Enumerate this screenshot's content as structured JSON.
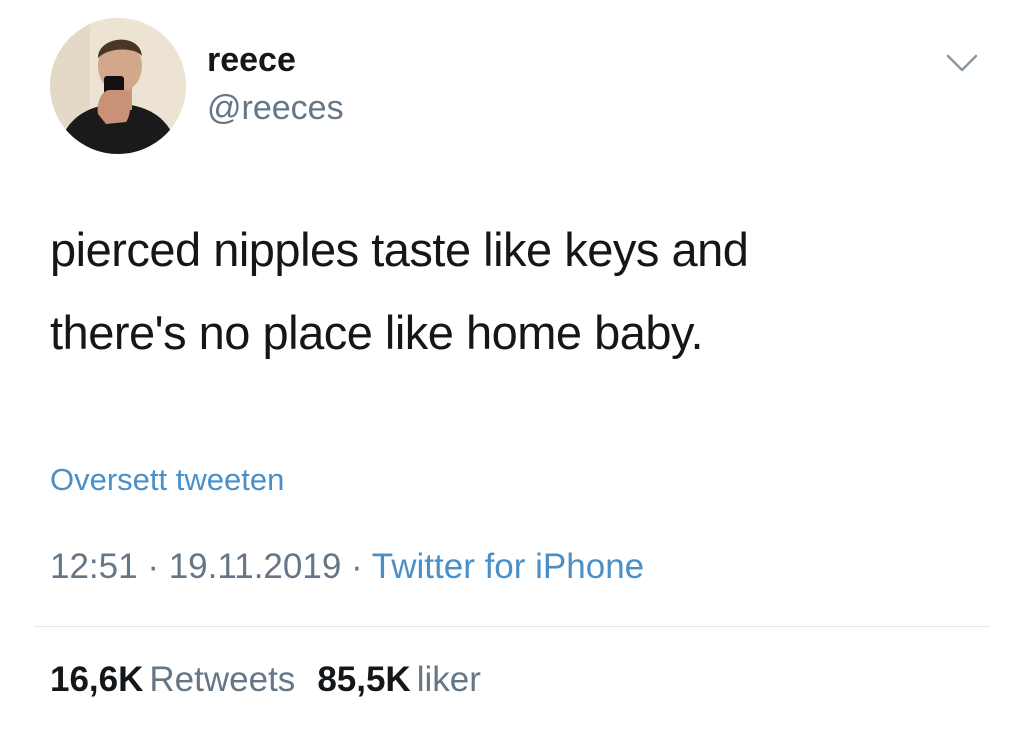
{
  "user": {
    "display_name": "reece",
    "handle": "@reeces"
  },
  "icons": {
    "more": "chevron-down-icon",
    "avatar": "avatar-photo"
  },
  "tweet": {
    "lines": [
      "pierced nipples taste like keys and",
      "there's no place like home baby."
    ],
    "translate_label": "Oversett tweeten",
    "time": "12:51",
    "separator": "·",
    "date": "19.11.2019",
    "source": "Twitter for iPhone"
  },
  "stats": {
    "retweets_count": "16,6K",
    "retweets_label": "Retweets",
    "likes_count": "85,5K",
    "likes_label": "liker"
  },
  "colors": {
    "text": "#14171a",
    "secondary": "#657786",
    "link": "#4a90c8",
    "divider": "#e1e8ed"
  }
}
